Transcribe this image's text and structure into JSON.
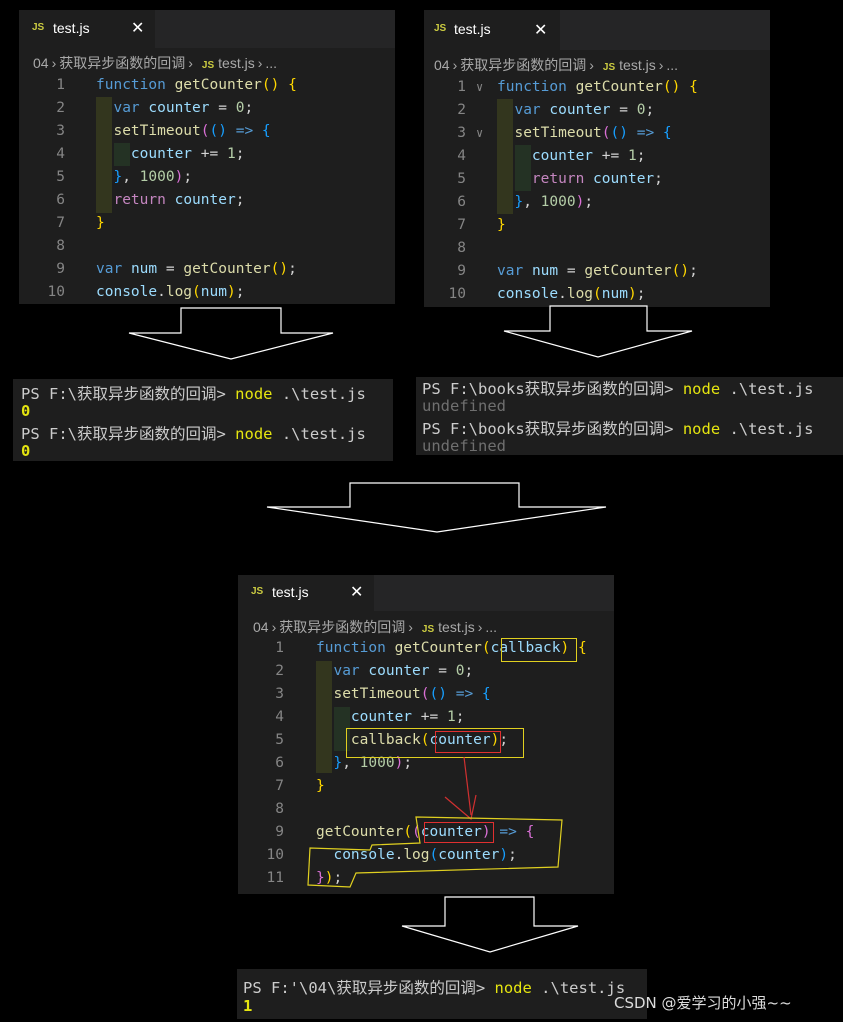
{
  "editor_tab": {
    "icon": "JS",
    "filename": "test.js",
    "close": "✕"
  },
  "breadcrumb": {
    "folder": "04",
    "chevron": "›",
    "dir": "获取异步函数的回调",
    "icon": "JS",
    "file": "test.js",
    "more": "..."
  },
  "panel1": {
    "line_numbers": [
      "1",
      "2",
      "3",
      "4",
      "5",
      "6",
      "7",
      "8",
      "9",
      "10"
    ]
  },
  "panel2": {
    "line_numbers": [
      "1",
      "2",
      "3",
      "4",
      "5",
      "6",
      "7",
      "8",
      "9",
      "10"
    ]
  },
  "panel3": {
    "line_numbers": [
      "1",
      "2",
      "3",
      "4",
      "5",
      "6",
      "7",
      "8",
      "9",
      "10",
      "11"
    ]
  },
  "terminal1": {
    "lines": [
      {
        "prompt": "PS F:\\获取异步函数的回调>",
        "command": "node",
        "args": " .\\test.js"
      },
      {
        "output": "0"
      },
      {
        "prompt": "PS F:\\获取异步函数的回调>",
        "command": "node",
        "args": " .\\test.js"
      },
      {
        "output": "0"
      }
    ]
  },
  "terminal2": {
    "lines": [
      {
        "prompt": "PS F:\\books获取异步函数的回调>",
        "command": "node",
        "args": " .\\test.js"
      },
      {
        "output": "undefined"
      },
      {
        "prompt": "PS F:\\books获取异步函数的回调>",
        "command": "node",
        "args": " .\\test.js"
      },
      {
        "output": "undefined"
      }
    ]
  },
  "terminal3": {
    "lines": [
      {
        "prompt": "PS F:'\\04\\获取异步函数的回调>",
        "command": "node",
        "args": " .\\test.js"
      },
      {
        "output": "1"
      }
    ]
  },
  "watermark": "CSDN @爱学习的小强~~",
  "colors": {
    "editor_bg": "#1e1e1e",
    "tab_bar": "#252526",
    "keyword": "#569cd6",
    "function": "#dcdcaa",
    "variable": "#9cdcfe",
    "number": "#b5cea8",
    "terminal_cmd": "#e5e510",
    "highlight_yellow": "#e0d020",
    "highlight_red": "#e03030"
  }
}
